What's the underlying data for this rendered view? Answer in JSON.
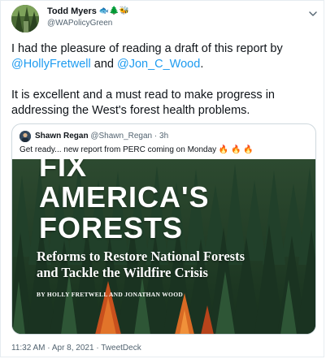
{
  "author": {
    "name": "Todd Myers",
    "emoji": "🐟🌲🐝",
    "handle": "@WAPolicyGreen"
  },
  "tweet": {
    "intro": "I had the pleasure of reading a draft of this report by",
    "mention1": "@HollyFretwell",
    "and": "and",
    "mention2": "@Jon_C_Wood",
    "period": ".",
    "para2": "It is excellent and a must read to make progress in addressing the West's forest health problems."
  },
  "quote": {
    "name": "Shawn Regan",
    "handle": "@Shawn_Regan",
    "sep": "·",
    "time": "3h",
    "text": "Get ready... new report from PERC coming on Monday",
    "fire_emoji": "🔥 🔥 🔥"
  },
  "cover": {
    "title_line1": "FIX",
    "title_line2": "AMERICA'S",
    "title_line3": "FORESTS",
    "subtitle_line1": "Reforms to Restore National Forests",
    "subtitle_line2": "and Tackle the Wildfire Crisis",
    "authors": "BY HOLLY FRETWELL AND JONATHAN WOOD"
  },
  "footer": {
    "timestamp": "11:32 AM · Apr 8, 2021 · TweetDeck"
  },
  "colors": {
    "link": "#1d9bf0",
    "text": "#0f1419",
    "muted": "#536471",
    "border": "#cfd9de",
    "forest": "#1e3b25"
  },
  "icons": {
    "menu": "caret-down-icon"
  }
}
